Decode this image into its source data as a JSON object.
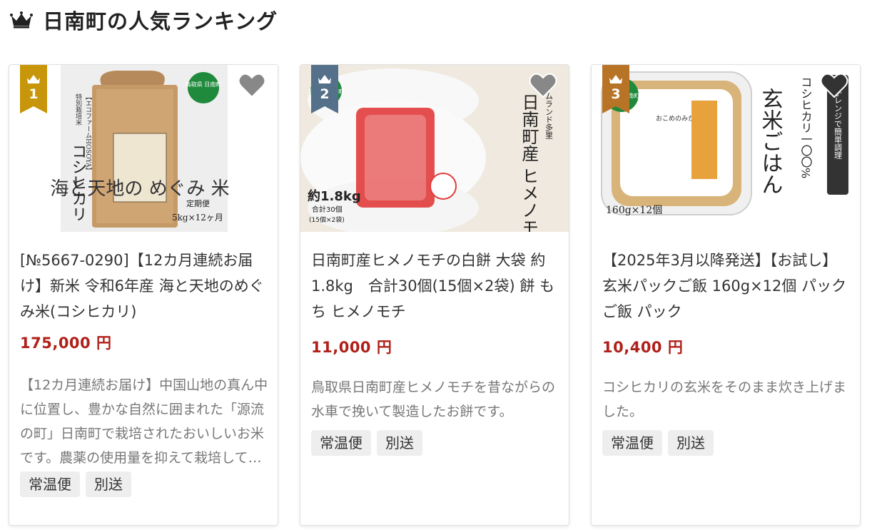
{
  "header": {
    "title": "日南町の人気ランキング",
    "icon": "crown-icon"
  },
  "colors": {
    "price": "#b0201a",
    "rank_gold": "#c8960a",
    "rank_silver": "#55708a",
    "rank_bronze": "#b87426"
  },
  "products": [
    {
      "rank": "1",
      "title": "[№5667-0290]【12カ月連続お届け】新米 令和6年産 海と天地のめぐみ米(コシヒカリ)",
      "price": "175,000 円",
      "description": "【12カ月連続お届け】中国山地の真ん中に位置し、豊かな自然に囲まれた「源流の町」日南町で栽培されたおいしいお米です。農薬の使用量を抑えて栽培しています。",
      "tags": [
        "常温便",
        "別送"
      ],
      "image": {
        "brand": "【エコファームHOSOYA】",
        "type": "特別栽培米",
        "name": "コシヒカリ",
        "label": "海と天地の めぐみ 米",
        "delivery": "定期便",
        "quantity": "5kg×12ヶ月",
        "seal": "鳥取県 日南町"
      }
    },
    {
      "rank": "2",
      "title": "日南町産ヒメノモチの白餅 大袋 約1.8kg　合計30個(15個×2袋) 餅 もち ヒメノモチ",
      "price": "11,000 円",
      "description": "鳥取県日南町産ヒメノモチを昔ながらの水車で挽いて製造したお餅です。",
      "tags": [
        "常温便",
        "別送"
      ],
      "image": {
        "heading": "日南町産 ヒメノモチの白餅 大袋",
        "maker": "ホームランド多里",
        "weight": "約1.8kg",
        "count": "合計30個",
        "breakdown": "(15個×2袋)",
        "seal": "鳥取県 日南町"
      }
    },
    {
      "rank": "3",
      "title": "【2025年3月以降発送】【お試し】玄米パックご飯 160g×12個 パックご飯 パック",
      "price": "10,400 円",
      "description": "コシヒカリの玄米をそのまま炊き上げました。",
      "tags": [
        "常温便",
        "別送"
      ],
      "image": {
        "heading": "玄米ごはん",
        "sub": "コシヒカリ一〇〇%",
        "badge": "電子レンジで簡単調理",
        "pack": "160g×12個",
        "seal": "鳥取県 日南町",
        "lid": "おこめのみかた"
      }
    }
  ]
}
